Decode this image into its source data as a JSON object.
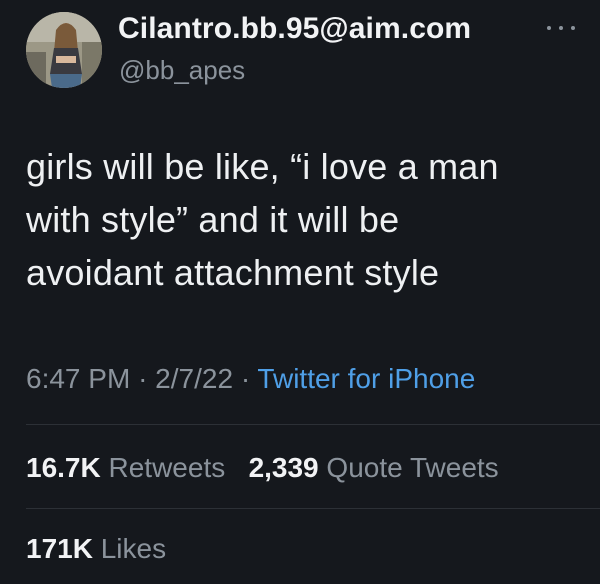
{
  "author": {
    "display_name": "Cilantro.bb.95@aim.com",
    "handle": "@bb_apes",
    "avatar_icon": "profile-photo"
  },
  "tweet": {
    "text_lines": [
      "girls will be like, “i love a man",
      "with style” and it will be",
      "avoidant attachment style"
    ],
    "time": "6:47 PM",
    "date": "2/7/22",
    "separator": "·",
    "source": "Twitter for iPhone"
  },
  "stats": {
    "retweets_count": "16.7K",
    "retweets_label": "Retweets",
    "quotes_count": "2,339",
    "quotes_label": "Quote Tweets",
    "likes_count": "171K",
    "likes_label": "Likes"
  },
  "colors": {
    "background": "#15181d",
    "text": "#eef0f2",
    "secondary": "#8b939c",
    "link": "#4f9fe7"
  },
  "icons": {
    "more": "more-horizontal-icon"
  }
}
